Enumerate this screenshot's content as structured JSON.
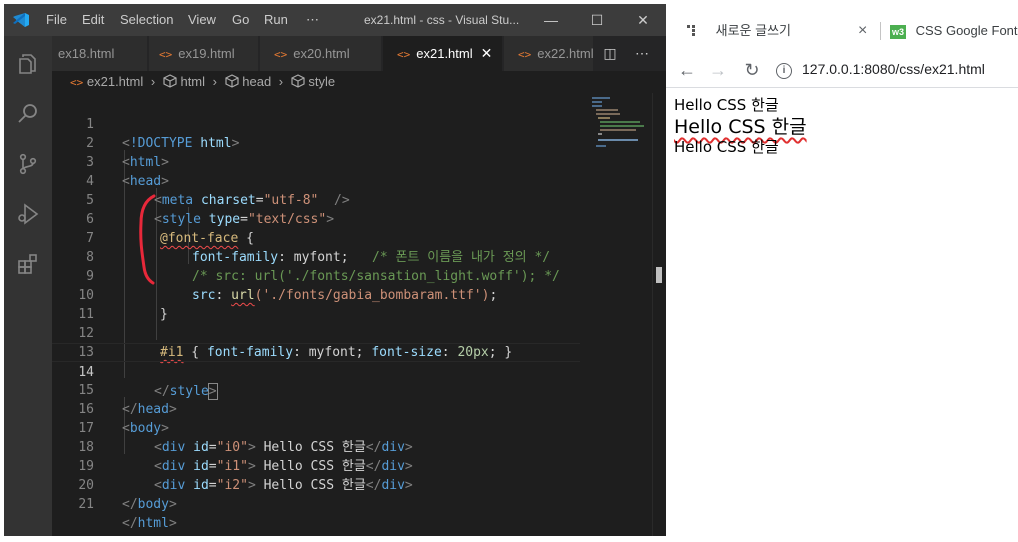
{
  "vscode": {
    "menu": [
      "File",
      "Edit",
      "Selection",
      "View",
      "Go",
      "Run",
      "⋯"
    ],
    "window_title": "ex21.html - css - Visual Stu...",
    "tabs": [
      {
        "label": "ex18.html",
        "active": false
      },
      {
        "label": "ex19.html",
        "active": false
      },
      {
        "label": "ex20.html",
        "active": false
      },
      {
        "label": "ex21.html",
        "active": true
      },
      {
        "label": "ex22.html",
        "active": false
      }
    ],
    "tab_icon": "<>",
    "breadcrumb": [
      "ex21.html",
      "html",
      "head",
      "style"
    ],
    "line_numbers": [
      "1",
      "2",
      "3",
      "4",
      "5",
      "6",
      "7",
      "8",
      "9",
      "10",
      "11",
      "12",
      "13",
      "14",
      "15",
      "16",
      "17",
      "18",
      "19",
      "20",
      "21"
    ],
    "code": {
      "l1": {
        "open": "<",
        "kw": "!DOCTYPE",
        "name": "html",
        "close": ">"
      },
      "l2": {
        "open": "<",
        "tag": "html",
        "close": ">"
      },
      "l3": {
        "open": "<",
        "tag": "head",
        "close": ">"
      },
      "l4": {
        "open": "<",
        "tag": "meta",
        "attr": "charset",
        "eq": "=",
        "val": "\"utf-8\"",
        "close": "  />"
      },
      "l5": {
        "open": "<",
        "tag": "style",
        "attr": "type",
        "eq": "=",
        "val": "\"text/css\"",
        "close": ">"
      },
      "l6": {
        "at": "@font-face",
        "brace": " {"
      },
      "l7": {
        "prop": "font-family",
        "colon": ": ",
        "value": "myfont;",
        "comment": "   /* 폰트 이름을 내가 정의 */"
      },
      "l8": {
        "comment": "/* src: url('./fonts/sansation_light.woff'); */"
      },
      "l9": {
        "prop": "src",
        "colon": ": ",
        "fn": "url",
        "arg": "('./fonts/gabia_bombaram.ttf')",
        "end": ";"
      },
      "l10": {
        "brace": "}"
      },
      "l12": {
        "selector": "#i1",
        "open": " { ",
        "p1": "font-family",
        "v1": ": myfont; ",
        "p2": "font-size",
        "c2": ": ",
        "v2": "20px",
        "close": "; }"
      },
      "l14": {
        "open": "</",
        "tag": "style",
        "close": ">"
      },
      "l15": {
        "open": "</",
        "tag": "head",
        "close": ">"
      },
      "l16": {
        "open": "<",
        "tag": "body",
        "close": ">"
      },
      "l17": {
        "open": "<",
        "tag": "div",
        "attr": "id",
        "eq": "=",
        "val": "\"i0\"",
        "gt": ">",
        "text": " Hello CSS 한글",
        "end_open": "</",
        "end_tag": "div",
        "end_close": ">"
      },
      "l18": {
        "open": "<",
        "tag": "div",
        "attr": "id",
        "eq": "=",
        "val": "\"i1\"",
        "gt": ">",
        "text": " Hello CSS 한글",
        "end_open": "</",
        "end_tag": "div",
        "end_close": ">"
      },
      "l19": {
        "open": "<",
        "tag": "div",
        "attr": "id",
        "eq": "=",
        "val": "\"i2\"",
        "gt": ">",
        "text": " Hello CSS 한글",
        "end_open": "</",
        "end_tag": "div",
        "end_close": ">"
      },
      "l20": {
        "open": "</",
        "tag": "body",
        "close": ">"
      },
      "l21": {
        "open": "</",
        "tag": "html",
        "close": ">"
      }
    },
    "colors": {
      "accent": "#007acc",
      "tab_icon": "#e37933",
      "annotation": "#e8283a"
    },
    "icons": [
      "vscode-logo-icon",
      "explorer-icon",
      "search-icon",
      "source-control-icon",
      "run-debug-icon",
      "extensions-icon",
      "split-editor-icon",
      "more-actions-icon",
      "close-icon",
      "minimize-icon",
      "maximize-icon"
    ]
  },
  "browser": {
    "tabs": [
      {
        "label": "새로운 글쓰기",
        "close": "×"
      },
      {
        "label": "CSS Google Fonts",
        "favicon": "w3"
      }
    ],
    "url": "127.0.0.1:8080/css/ex21.html",
    "page_lines": [
      "Hello CSS 한글",
      "Hello CSS 한글",
      "Hello CSS 한글"
    ],
    "icons": [
      "back-icon",
      "forward-icon",
      "reload-icon",
      "site-info-icon",
      "tab-favicon-icon"
    ]
  }
}
